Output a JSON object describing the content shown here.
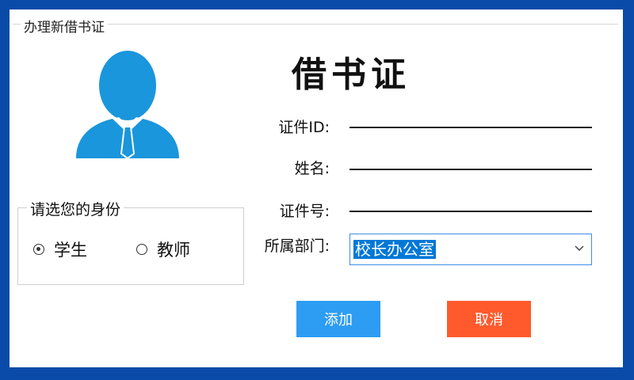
{
  "window": {
    "group_title": "办理新借书证"
  },
  "card": {
    "title": "借书证"
  },
  "fields": {
    "id_label": "证件ID:",
    "name_label": "姓名:",
    "number_label": "证件号:",
    "dept_label": "所属部门:",
    "dept_value": "校长办公室"
  },
  "identity": {
    "title": "请选您的身份",
    "options": [
      {
        "label": "学生",
        "checked": true
      },
      {
        "label": "教师",
        "checked": false
      }
    ]
  },
  "buttons": {
    "add": "添加",
    "cancel": "取消"
  },
  "colors": {
    "frame": "#0a4aa8",
    "avatar": "#1a96dc",
    "add_button": "#2d9cf3",
    "cancel_button": "#ff5a2c",
    "selection": "#0078d7"
  },
  "icons": {
    "avatar": "user-avatar-icon",
    "dropdown": "chevron-down-icon"
  }
}
